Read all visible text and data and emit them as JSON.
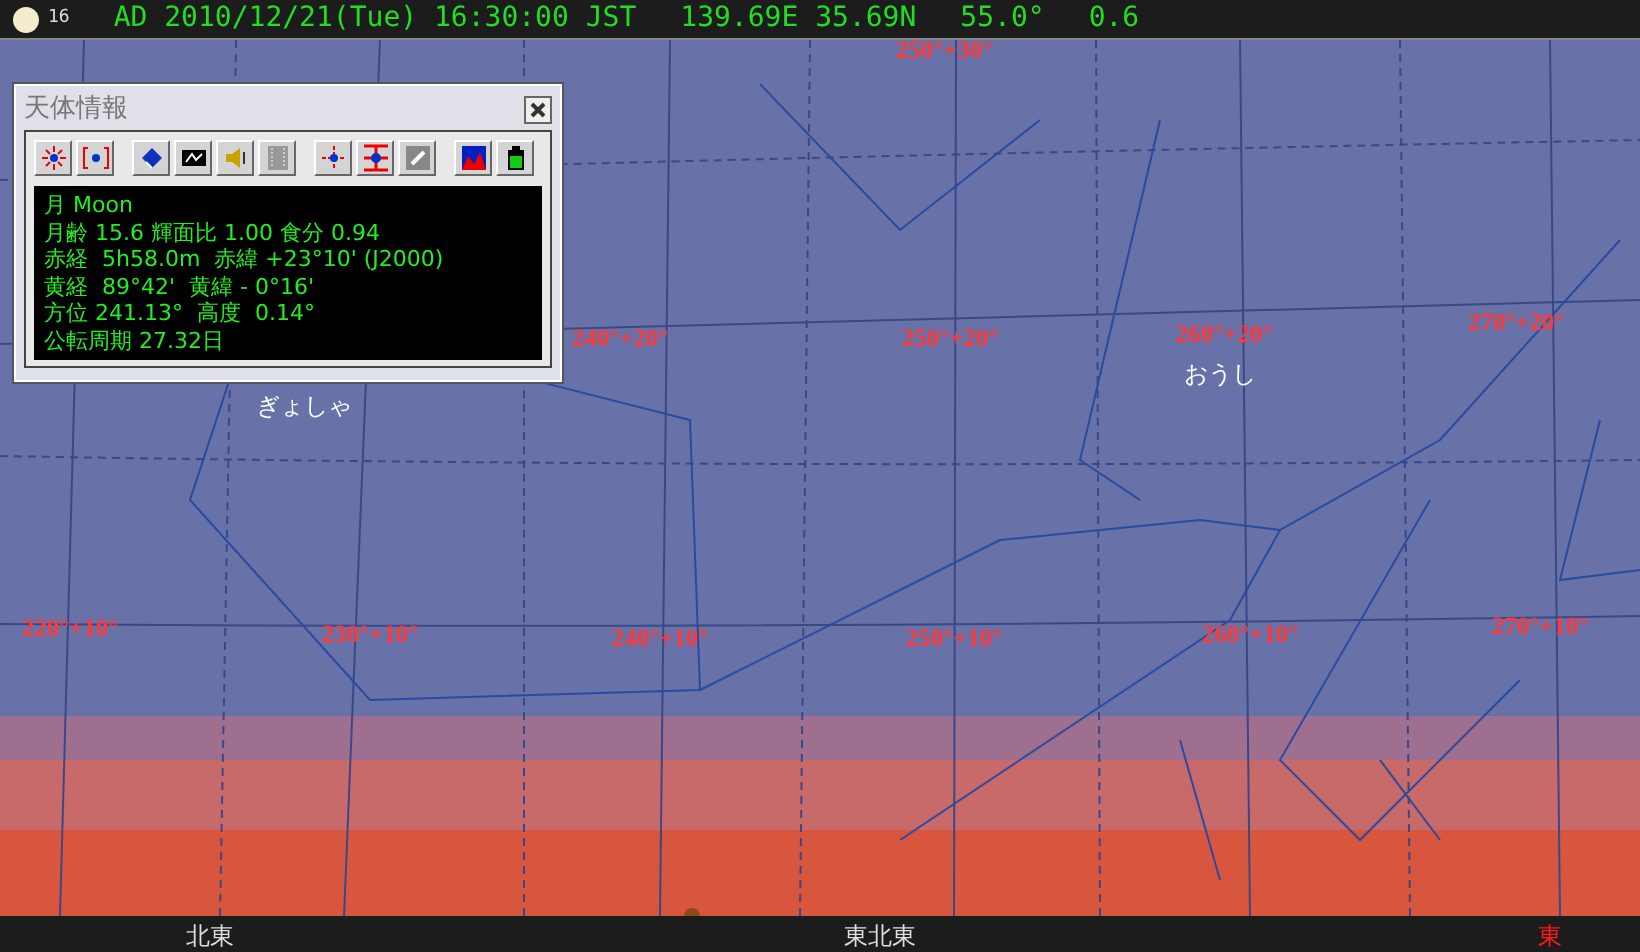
{
  "status_bar": {
    "phase_number": "16",
    "datetime": "AD 2010/12/21(Tue) 16:30:00 JST",
    "location": "139.69E 35.69N",
    "angle": "55.0°",
    "value": "0.6"
  },
  "sky": {
    "grid_labels": [
      "250°+30°",
      "240°+20°",
      "250°+20°",
      "260°+20°",
      "270°+20°",
      "220°+10°",
      "230°+10°",
      "240°+10°",
      "250°+10°",
      "260°+10°",
      "270°+10°"
    ],
    "constellations": [
      "ぎょしゃ",
      "おうし"
    ]
  },
  "info_window": {
    "title": "天体情報",
    "lines": [
      "月 Moon",
      "月齢 15.6 輝面比 1.00 食分 0.94",
      "赤経  5h58.0m  赤緯 +23°10' (J2000)",
      "黄経  89°42'  黄緯 - 0°16'",
      "方位 241.13°  高度  0.14°",
      "公転周期 27.32日"
    ]
  },
  "compass": [
    {
      "label": "北東",
      "highlighted": false
    },
    {
      "label": "東北東",
      "highlighted": false
    },
    {
      "label": "東",
      "highlighted": true
    }
  ]
}
